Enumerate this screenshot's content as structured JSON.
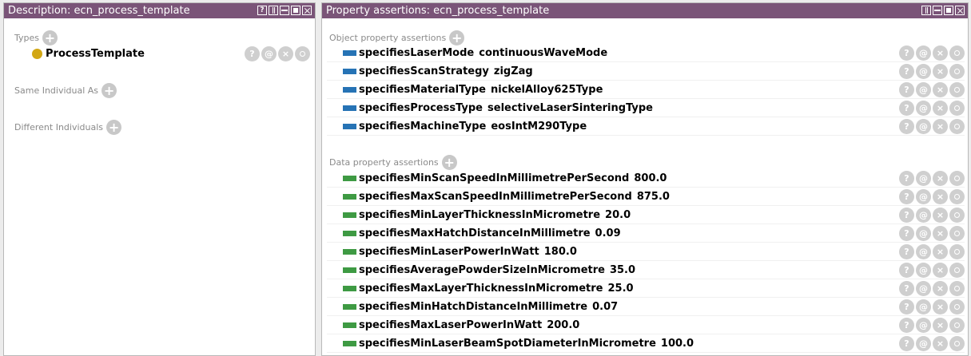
{
  "left_panel": {
    "title": "Description: ecn_process_template",
    "types_label": "Types",
    "type_item": "ProcessTemplate",
    "same_individual_label": "Same Individual As",
    "different_individuals_label": "Different Individuals"
  },
  "right_panel": {
    "title": "Property assertions: ecn_process_template",
    "object_label": "Object property assertions",
    "data_label": "Data property assertions",
    "object_assertions": [
      {
        "property": "specifiesLaserMode",
        "value": "continuousWaveMode"
      },
      {
        "property": "specifiesScanStrategy",
        "value": "zigZag"
      },
      {
        "property": "specifiesMaterialType",
        "value": "nickelAlloy625Type"
      },
      {
        "property": "specifiesProcessType",
        "value": "selectiveLaserSinteringType"
      },
      {
        "property": "specifiesMachineType",
        "value": "eosIntM290Type"
      }
    ],
    "data_assertions": [
      {
        "property": "specifiesMinScanSpeedInMillimetrePerSecond",
        "value": "800.0"
      },
      {
        "property": "specifiesMaxScanSpeedInMillimetrePerSecond",
        "value": "875.0"
      },
      {
        "property": "specifiesMinLayerThicknessInMicrometre",
        "value": "20.0"
      },
      {
        "property": "specifiesMaxHatchDistanceInMillimetre",
        "value": "0.09"
      },
      {
        "property": "specifiesMinLaserPowerInWatt",
        "value": "180.0"
      },
      {
        "property": "specifiesAveragePowderSizeInMicrometre",
        "value": "35.0"
      },
      {
        "property": "specifiesMaxLayerThicknessInMicrometre",
        "value": "25.0"
      },
      {
        "property": "specifiesMinHatchDistanceInMillimetre",
        "value": "0.07"
      },
      {
        "property": "specifiesMaxLaserPowerInWatt",
        "value": "200.0"
      },
      {
        "property": "specifiesMinLaserBeamSpotDiameterInMicrometre",
        "value": "100.0"
      }
    ]
  },
  "icons": {
    "add": "+",
    "help": "?",
    "annotate": "@",
    "delete": "×"
  },
  "colors": {
    "titlebar": "#7a5478",
    "object_property": "#2673b5",
    "data_property": "#3e9a43",
    "individual": "#d2a714"
  }
}
